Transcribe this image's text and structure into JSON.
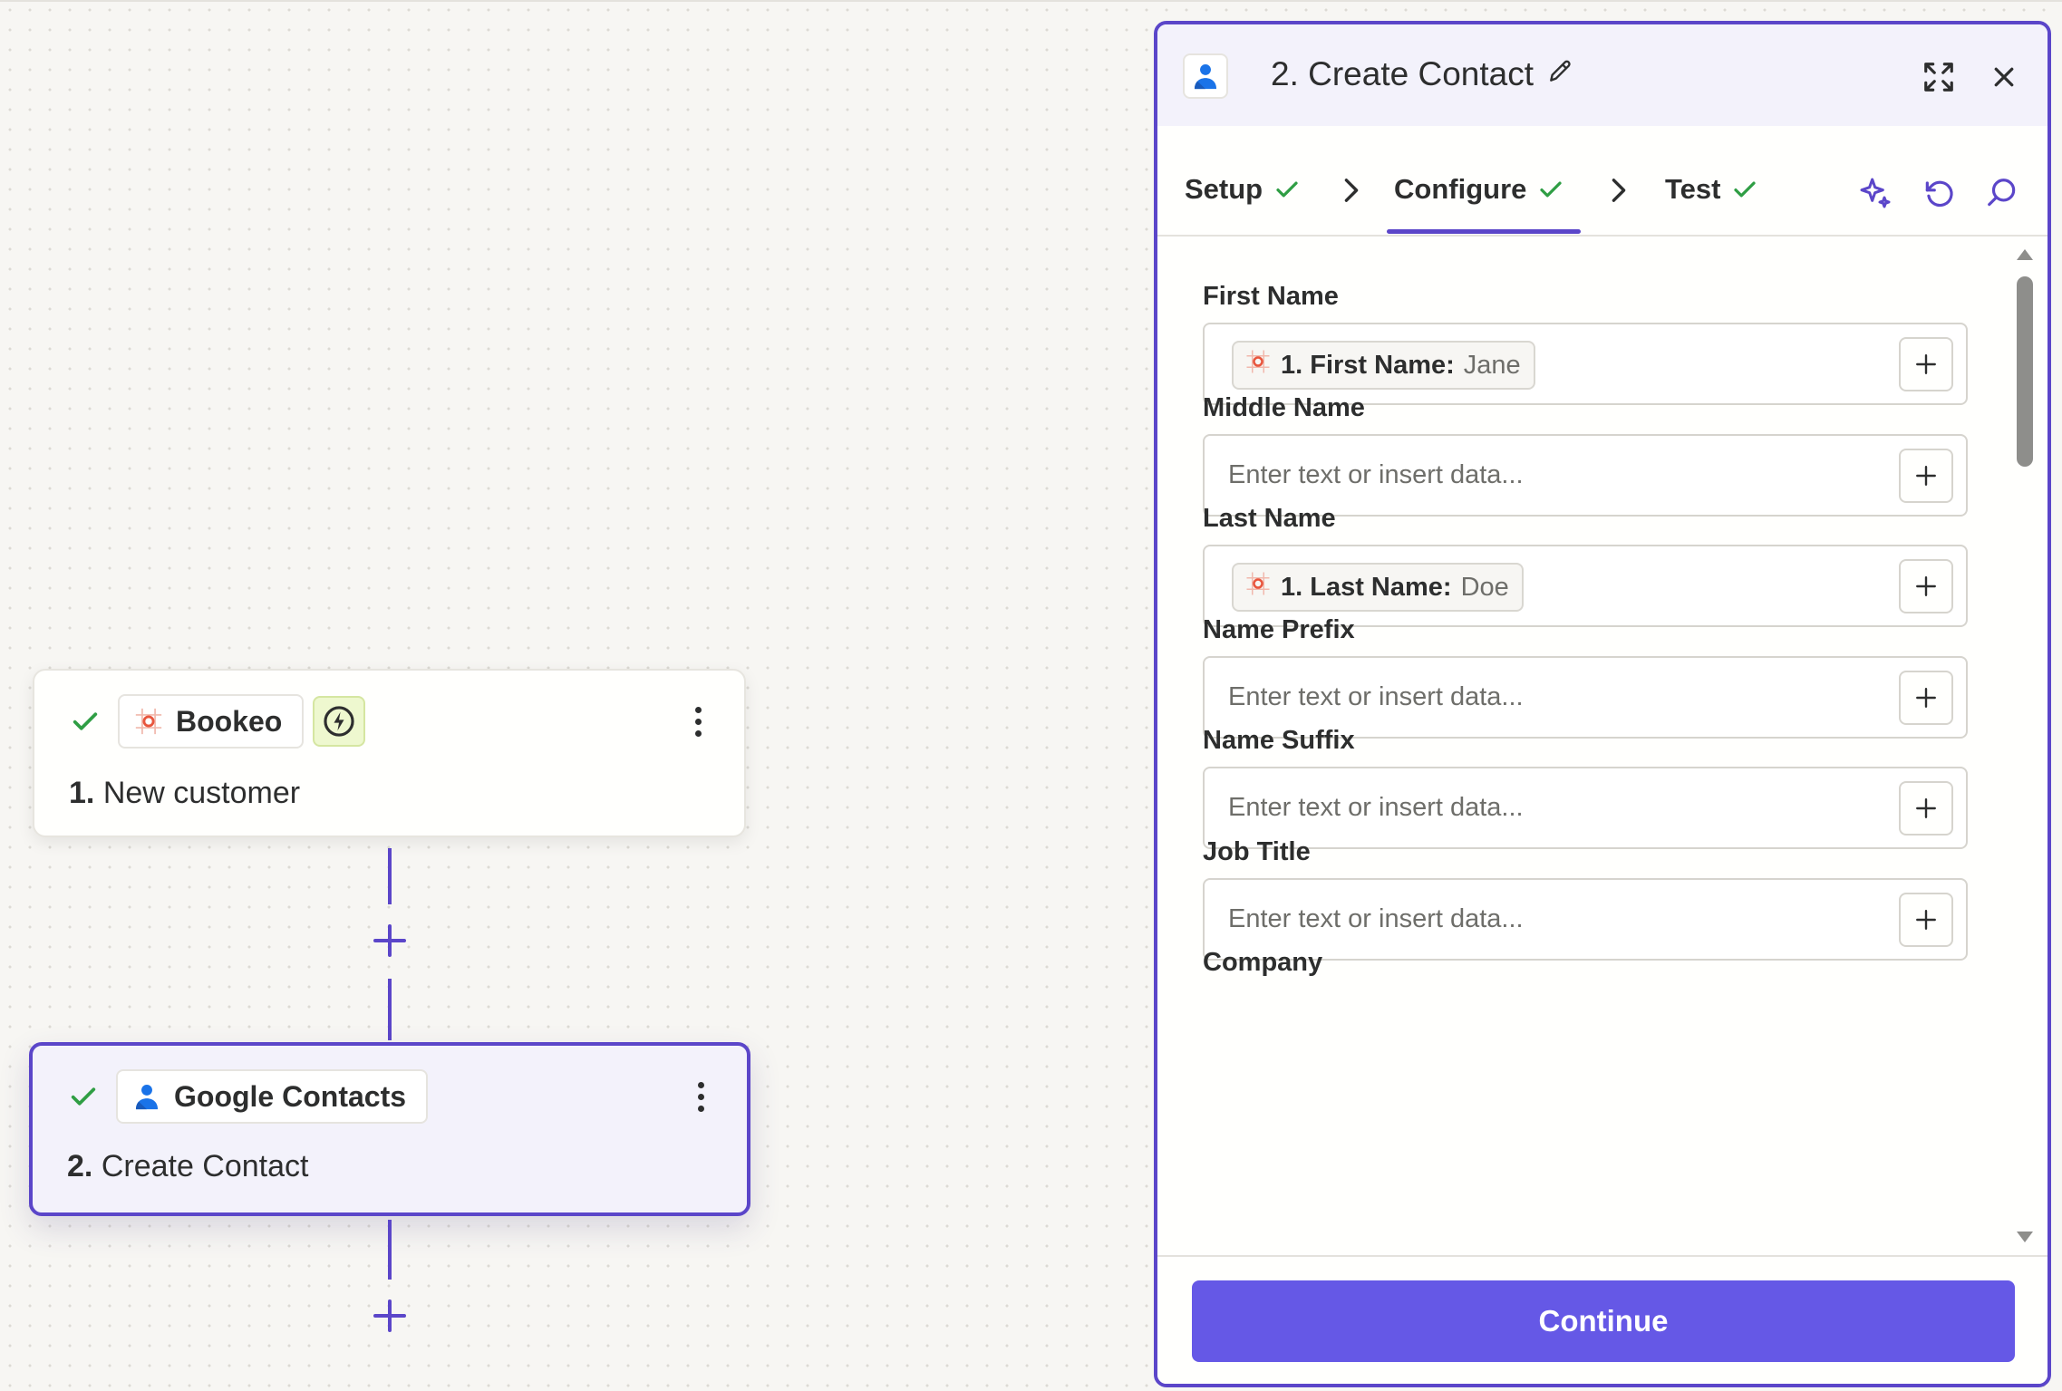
{
  "canvas": {
    "step1": {
      "app_name": "Bookeo",
      "step_number": "1.",
      "title": "New customer"
    },
    "step2": {
      "app_name": "Google Contacts",
      "step_number": "2.",
      "title": "Create Contact"
    }
  },
  "panel": {
    "title": "2. Create Contact",
    "tabs": [
      {
        "label": "Setup"
      },
      {
        "label": "Configure"
      },
      {
        "label": "Test"
      }
    ],
    "fields": [
      {
        "label": "First Name",
        "pill_key": "1. First Name:",
        "pill_value": "Jane"
      },
      {
        "label": "Middle Name",
        "placeholder": "Enter text or insert data..."
      },
      {
        "label": "Last Name",
        "pill_key": "1. Last Name:",
        "pill_value": "Doe"
      },
      {
        "label": "Name Prefix",
        "placeholder": "Enter text or insert data..."
      },
      {
        "label": "Name Suffix",
        "placeholder": "Enter text or insert data..."
      },
      {
        "label": "Job Title",
        "placeholder": "Enter text or insert data..."
      },
      {
        "label": "Company"
      }
    ],
    "continue_label": "Continue"
  },
  "colors": {
    "accent": "#5b46c9",
    "button": "#6558e6",
    "success": "#2f9e44",
    "bookeo": "#e8563e",
    "google_contacts": "#1a73e8"
  },
  "icons": {
    "check": "check-icon",
    "bolt": "bolt-icon",
    "more": "kebab-icon",
    "edit": "pencil-icon",
    "expand": "expand-icon",
    "close": "close-icon",
    "ai": "sparkle-icon",
    "undo": "undo-icon",
    "search": "search-icon",
    "add": "plus-icon"
  }
}
